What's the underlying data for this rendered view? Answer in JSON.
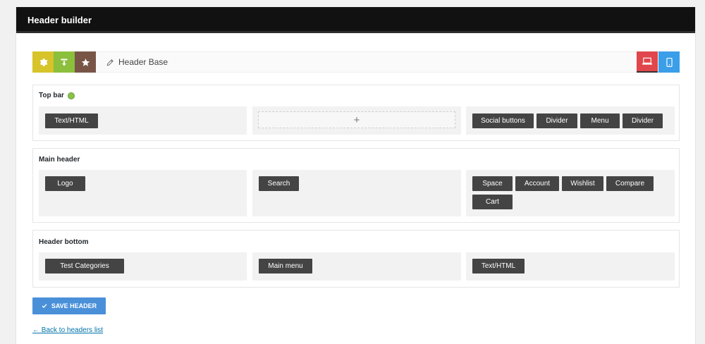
{
  "window": {
    "title": "Header builder"
  },
  "toolbar": {
    "header_name": "Header Base",
    "icons": [
      "gear-icon",
      "import-icon",
      "star-icon",
      "desktop-icon",
      "mobile-icon"
    ]
  },
  "sections": {
    "top_bar": {
      "title": "Top bar",
      "left": [
        "Text/HTML"
      ],
      "center_add": "+",
      "right": [
        "Social buttons",
        "Divider",
        "Menu",
        "Divider"
      ]
    },
    "main_header": {
      "title": "Main header",
      "left": [
        "Logo"
      ],
      "center": [
        "Search"
      ],
      "right": [
        "Space",
        "Account",
        "Wishlist",
        "Compare",
        "Cart"
      ]
    },
    "header_bottom": {
      "title": "Header bottom",
      "left": [
        "Test Categories"
      ],
      "center": [
        "Main menu"
      ],
      "right": [
        "Text/HTML"
      ]
    }
  },
  "actions": {
    "save_label": "SAVE HEADER",
    "back_label": "← Back to headers list"
  },
  "colors": {
    "title_bar": "#111111",
    "settings": "#d6c42a",
    "import": "#8bbf3c",
    "favorite": "#795548",
    "desktop": "#e0464b",
    "mobile": "#3a9ee8",
    "chip": "#444444",
    "save": "#4a90d9"
  }
}
